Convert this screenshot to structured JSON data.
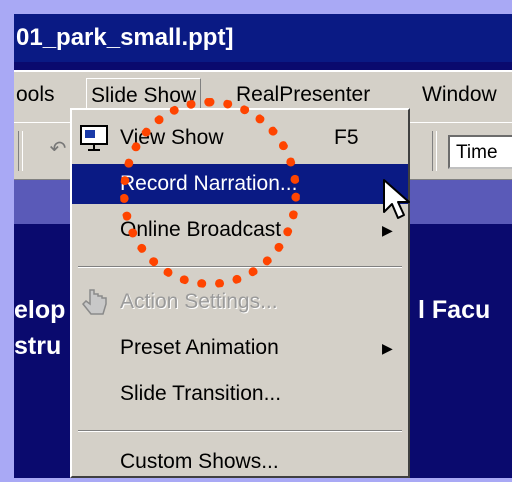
{
  "window": {
    "title": "01_park_small.ppt]"
  },
  "menubar": {
    "items": [
      {
        "label": "ools"
      },
      {
        "label": "Slide Show"
      },
      {
        "label": "RealPresenter"
      },
      {
        "label": "Window"
      }
    ]
  },
  "toolbar": {
    "font_value": "Time"
  },
  "slide": {
    "line1_left": "elop",
    "line2_left": "stru",
    "line1_right": "l Facu"
  },
  "slide_show_menu": {
    "items": [
      {
        "label": "View Show",
        "shortcut": "F5",
        "icon": "view-show-icon",
        "state": "normal"
      },
      {
        "label": "Record Narration...",
        "state": "highlighted"
      },
      {
        "label": "Online Broadcast",
        "submenu": true,
        "state": "normal"
      },
      {
        "label": "Action Settings...",
        "icon": "hand-pointer-icon",
        "state": "disabled"
      },
      {
        "label": "Preset Animation",
        "submenu": true,
        "state": "normal"
      },
      {
        "label": "Slide Transition...",
        "state": "normal"
      },
      {
        "label": "Custom Shows...",
        "state": "normal"
      }
    ]
  },
  "annotation": {
    "highlight_color": "#ff4400",
    "shape": "dotted-circle"
  },
  "colors": {
    "menu_highlight": "#0a1a84",
    "menu_bg": "#d4d0c8",
    "slide_bg": "#0a0a6e",
    "page_bg": "#a9a9f5"
  }
}
